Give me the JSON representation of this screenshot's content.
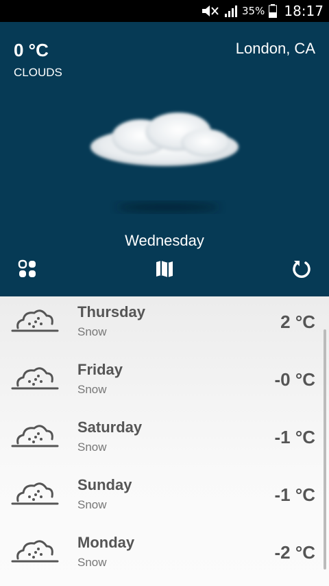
{
  "status_bar": {
    "battery_pct": "35%",
    "time": "18:17"
  },
  "current": {
    "temperature": "0 °C",
    "description": "CLOUDS",
    "location": "London, CA",
    "day": "Wednesday"
  },
  "toolbar": {
    "left_icon": "grid-icon",
    "center_icon": "map-icon",
    "right_icon": "refresh-icon"
  },
  "forecast": [
    {
      "day": "Thursday",
      "condition": "Snow",
      "temp": "2 °C"
    },
    {
      "day": "Friday",
      "condition": "Snow",
      "temp": "-0 °C"
    },
    {
      "day": "Saturday",
      "condition": "Snow",
      "temp": "-1 °C"
    },
    {
      "day": "Sunday",
      "condition": "Snow",
      "temp": "-1 °C"
    },
    {
      "day": "Monday",
      "condition": "Snow",
      "temp": "-2 °C"
    }
  ],
  "colors": {
    "hero_bg": "#063a55",
    "list_text": "#555555"
  }
}
